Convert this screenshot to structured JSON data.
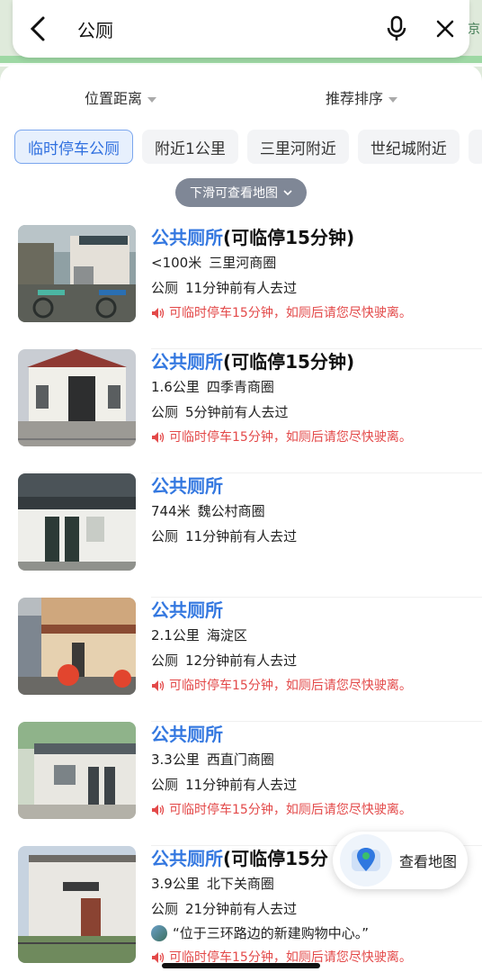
{
  "search": {
    "query": "公厕",
    "side_char": "京"
  },
  "filters": [
    {
      "label": "位置距离"
    },
    {
      "label": "推荐排序"
    }
  ],
  "chips": [
    "临时停车公厕",
    "附近1公里",
    "三里河附近",
    "世纪城附近"
  ],
  "hint": "下滑可查看地图",
  "results": [
    {
      "title": "公共厕所",
      "title_extra": "(可临停15分钟)",
      "distance": "<100米",
      "area": "三里河商圈",
      "type": "公厕",
      "visited": "11分钟前有人去过",
      "notice": "可临时停车15分钟，如厕后请您尽快驶离。"
    },
    {
      "title": "公共厕所",
      "title_extra": "(可临停15分钟)",
      "distance": "1.6公里",
      "area": "四季青商圈",
      "type": "公厕",
      "visited": "5分钟前有人去过",
      "notice": "可临时停车15分钟，如厕后请您尽快驶离。"
    },
    {
      "title": "公共厕所",
      "title_extra": "",
      "distance": "744米",
      "area": "魏公村商圈",
      "type": "公厕",
      "visited": "11分钟前有人去过",
      "notice": ""
    },
    {
      "title": "公共厕所",
      "title_extra": "",
      "distance": "2.1公里",
      "area": "海淀区",
      "type": "公厕",
      "visited": "12分钟前有人去过",
      "notice": "可临时停车15分钟，如厕后请您尽快驶离。"
    },
    {
      "title": "公共厕所",
      "title_extra": "",
      "distance": "3.3公里",
      "area": "西直门商圈",
      "type": "公厕",
      "visited": "11分钟前有人去过",
      "notice": "可临时停车15分钟，如厕后请您尽快驶离。"
    },
    {
      "title": "公共厕所",
      "title_extra": "(可临停15分",
      "distance": "3.9公里",
      "area": "北下关商圈",
      "type": "公厕",
      "visited": "21分钟前有人去过",
      "quote": "“位于三环路边的新建购物中心。”",
      "notice": "可临时停车15分钟，如厕后请您尽快驶离。"
    }
  ],
  "map_button": {
    "label": "查看地图"
  },
  "colors": {
    "accent": "#3478e0",
    "warning": "#e34949",
    "chip_active_bg": "#e7f0fd"
  }
}
